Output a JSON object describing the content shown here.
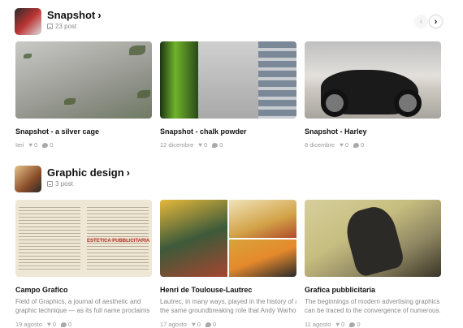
{
  "sections": [
    {
      "title": "Snapshot",
      "count": "23 post",
      "thumb_icon": "snapshot-collection-thumbnail",
      "cards": [
        {
          "title": "Snapshot - a silver cage",
          "desc": "",
          "date": "Ieri",
          "likes": "0",
          "comments": "0"
        },
        {
          "title": "Snapshot - chalk powder",
          "desc": "",
          "date": "12 dicembre",
          "likes": "0",
          "comments": "0"
        },
        {
          "title": "Snapshot - Harley",
          "desc": "",
          "date": "8 dicembre",
          "likes": "0",
          "comments": "0"
        }
      ]
    },
    {
      "title": "Graphic design",
      "count": "3 post",
      "thumb_icon": "graphic-design-collection-thumbnail",
      "cards": [
        {
          "title": "Campo Grafico",
          "desc1": "Field of Graphics, a journal of aesthetic and",
          "desc2": "graphic technique — as its full name proclaims ...",
          "date": "19 agosto",
          "likes": "0",
          "comments": "0",
          "overlay": "ESTETICA PUBBLICITARIA"
        },
        {
          "title": "Henri de Toulouse-Lautrec",
          "desc1": "Lautrec, in many ways, played in the history of art",
          "desc2": "the same groundbreaking role that Andy Warhol...",
          "date": "17 agosto",
          "likes": "0",
          "comments": "0"
        },
        {
          "title": "Grafica pubblicitaria",
          "desc1": "The beginnings of modern advertising graphics",
          "desc2": "can be traced to the convergence of numerous...",
          "date": "11 agosto",
          "likes": "0",
          "comments": "0"
        }
      ]
    }
  ],
  "nav": {
    "prev": "‹",
    "next": "›"
  },
  "chevron": "›",
  "colors": {
    "accent_red": "#c0392b",
    "muted": "#888888"
  }
}
